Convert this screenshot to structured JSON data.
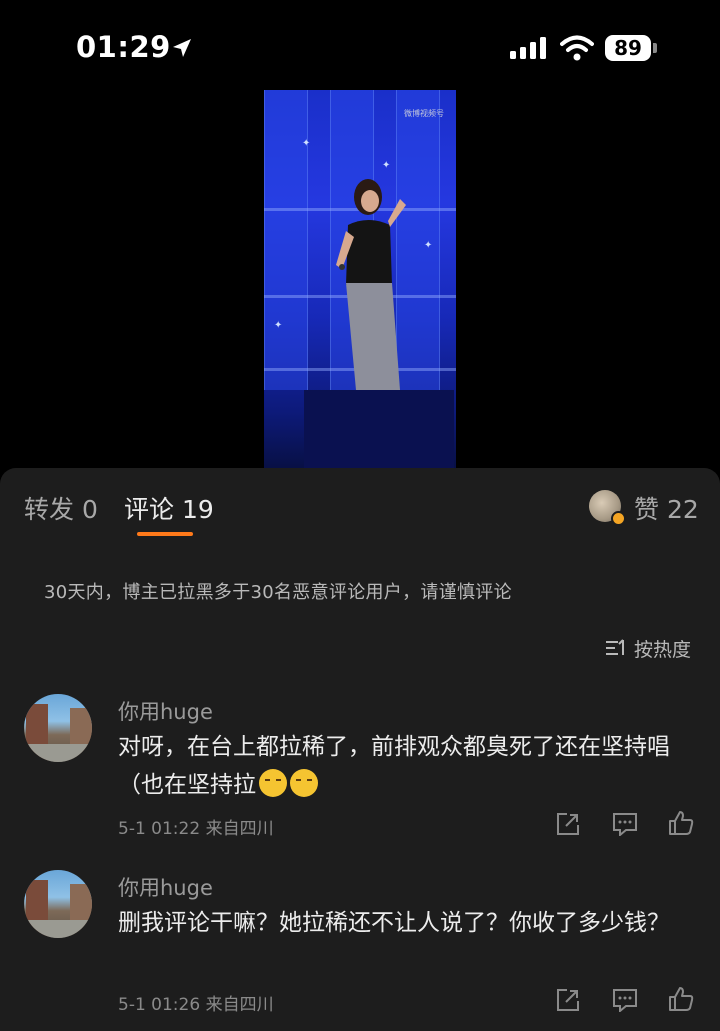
{
  "status_bar": {
    "time": "01:29",
    "battery": "89"
  },
  "video": {
    "watermark": "微博视频号"
  },
  "tabs": {
    "forward": "转发 0",
    "comments": "评论 19",
    "likes": "赞 22"
  },
  "notice": "30天内，博主已拉黑多于30名恶意评论用户，请谨慎评论",
  "sort_label": "按热度",
  "comments": [
    {
      "user": "你用huge",
      "text": "对呀，在台上都拉稀了，前排观众都臭死了还在坚持唱（也在坚持拉",
      "meta": "5-1 01:22 来自四川"
    },
    {
      "user": "你用huge",
      "text": "删我评论干嘛？她拉稀还不让人说了？你收了多少钱？",
      "meta": "5-1 01:26 来自四川"
    }
  ],
  "colors": {
    "accent": "#ff7a1a",
    "panel_bg": "#1d1d1d",
    "page_bg": "#000000"
  }
}
